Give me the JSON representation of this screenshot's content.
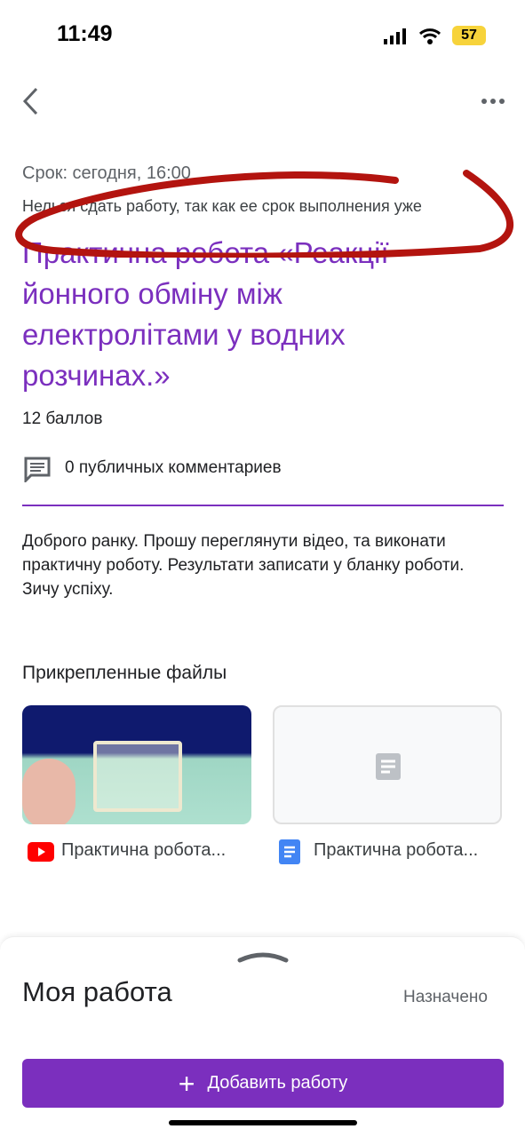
{
  "status": {
    "time": "11:49",
    "battery": "57"
  },
  "assignment": {
    "due": "Срок: сегодня, 16:00",
    "late_notice": "Нельзя сдать работу, так как ее срок выполнения уже",
    "title": "Практична робота «Реакції йонного обміну між електролітами у водних розчинах.»",
    "points": "12 баллов",
    "comments": "0 публичных комментариев",
    "description": "Доброго ранку. Прошу переглянути відео, та виконати практичну роботу. Результати записати у бланку роботи. Зичу успіху."
  },
  "attachments": {
    "heading": "Прикрепленные файлы",
    "items": [
      {
        "name": "Практична робота...",
        "icon": "youtube-icon"
      },
      {
        "name": "Практична робота...",
        "icon": "google-docs-icon"
      }
    ]
  },
  "my_work": {
    "title": "Моя работа",
    "status": "Назначено",
    "add_button": "Добавить работу"
  },
  "colors": {
    "accent": "#7b2fbe",
    "annotation": "#b3140f"
  }
}
